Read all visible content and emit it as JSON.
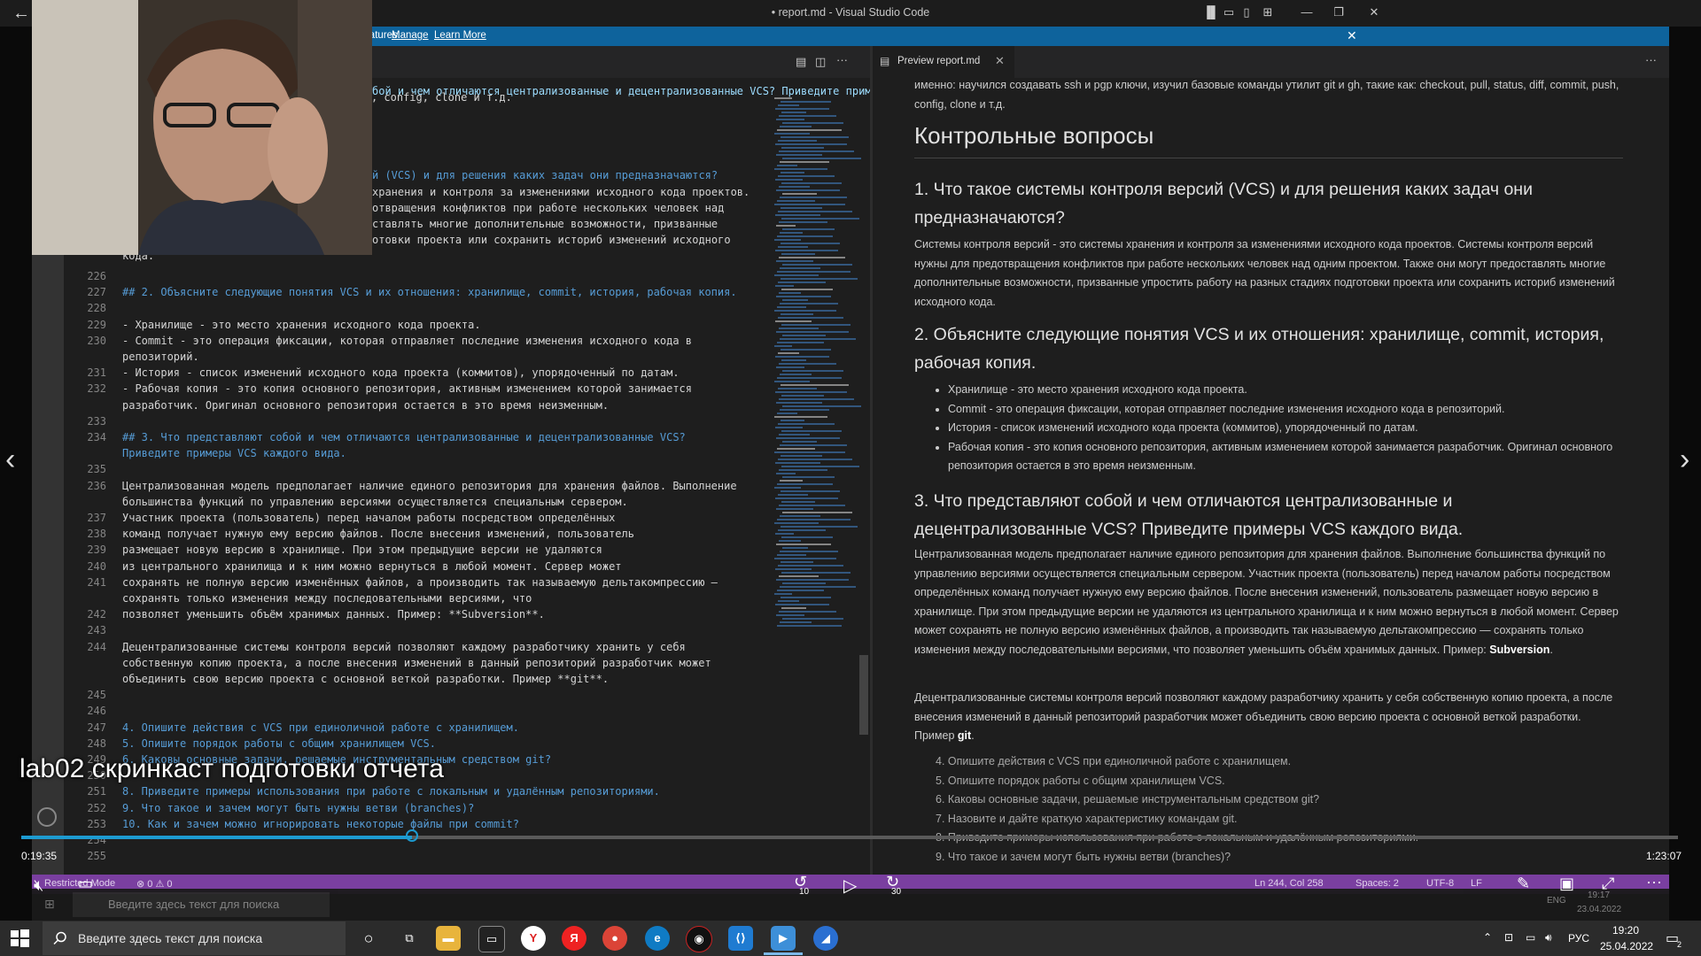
{
  "window": {
    "title": "• report.md - Visual Studio Code"
  },
  "infobar": {
    "message": "to enable all features.",
    "manage": "Manage",
    "learn_more": "Learn More"
  },
  "editor": {
    "line_top": "[], diff, commit, push, config, clone и т.д.",
    "question1_tail": "й (VCS) и для решения каких задач они предназначаются?",
    "q1_body": [
      "хранения и контроля за изменениями исходного кода проектов.",
      "отвращения конфликтов при работе нескольких человек над",
      "ставлять многие дополнительные возможности, призванные",
      "отовки проекта или сохранить историб изменений исходного"
    ],
    "q1_last": "кода.",
    "top_partial": "бой и чем отличаются централизованные и децентрализованные VCS? Приведите примеры V...",
    "lines": [
      {
        "n": "226",
        "t": "",
        "cls": ""
      },
      {
        "n": "227",
        "t": "## 2. Объясните следующие понятия VCS и их отношения: хранилище, commit, история, рабочая копия.",
        "cls": "h"
      },
      {
        "n": "228",
        "t": "",
        "cls": ""
      },
      {
        "n": "229",
        "t": "- Хранилище - это место хранения исходного кода проекта.",
        "cls": ""
      },
      {
        "n": "230",
        "t": "- Commit - это операция фиксации, которая отправляет последние изменения исходного кода в",
        "cls": ""
      },
      {
        "n": "",
        "t": "репозиторий.",
        "cls": ""
      },
      {
        "n": "231",
        "t": "- История - список изменений исходного кода проекта (коммитов), упорядоченный по датам.",
        "cls": ""
      },
      {
        "n": "232",
        "t": "- Рабочая копия - это копия основного репозитория, активным изменением которой занимается",
        "cls": ""
      },
      {
        "n": "",
        "t": "разработчик. Оригинал основного репозитория остается в это время неизменным.",
        "cls": ""
      },
      {
        "n": "233",
        "t": "",
        "cls": ""
      },
      {
        "n": "234",
        "t": "## 3. Что представляют собой и чем отличаются централизованные и децентрализованные VCS?",
        "cls": "h"
      },
      {
        "n": "",
        "t": "Приведите примеры VCS каждого вида.",
        "cls": "h"
      },
      {
        "n": "235",
        "t": "",
        "cls": ""
      },
      {
        "n": "236",
        "t": "Централизованная модель предполагает наличие единого репозитория для хранения файлов. Выполнение",
        "cls": ""
      },
      {
        "n": "",
        "t": "большинства функций по управлению версиями осуществляется специальным сервером.",
        "cls": ""
      },
      {
        "n": "237",
        "t": "Участник проекта (пользователь) перед началом работы посредством определённых",
        "cls": ""
      },
      {
        "n": "238",
        "t": "команд получает нужную ему версию файлов. После внесения изменений, пользователь",
        "cls": ""
      },
      {
        "n": "239",
        "t": "размещает новую версию в хранилище. При этом предыдущие версии не удаляются",
        "cls": ""
      },
      {
        "n": "240",
        "t": "из центрального хранилища и к ним можно вернуться в любой момент. Сервер может",
        "cls": ""
      },
      {
        "n": "241",
        "t": "сохранять не полную версию изменённых файлов, а производить так называемую дельтакомпрессию —",
        "cls": ""
      },
      {
        "n": "",
        "t": "сохранять только изменения между последовательными версиями, что",
        "cls": ""
      },
      {
        "n": "242",
        "t": "позволяет уменьшить объём хранимых данных. Пример: **Subversion**.",
        "cls": ""
      },
      {
        "n": "243",
        "t": "",
        "cls": ""
      },
      {
        "n": "244",
        "t": "Децентрализованные системы контроля версий позволяют каждому разработчику хранить у себя",
        "cls": ""
      },
      {
        "n": "",
        "t": "собственную копию проекта, а после внесения изменений в данный репозиторий разработчик может",
        "cls": ""
      },
      {
        "n": "",
        "t": "объединить свою версию проекта с основной веткой разработки. Пример **git**.",
        "cls": ""
      },
      {
        "n": "245",
        "t": "",
        "cls": ""
      },
      {
        "n": "246",
        "t": "",
        "cls": ""
      },
      {
        "n": "247",
        "t": "4. Опишите действия с VCS при единоличной работе с хранилищем.",
        "cls": "list"
      },
      {
        "n": "248",
        "t": "5. Опишите порядок работы с общим хранилищем VCS.",
        "cls": "list"
      },
      {
        "n": "249",
        "t": "6. Каковы основные задачи, решаемые инструментальным средством git?",
        "cls": "list"
      },
      {
        "n": "250",
        "t": "",
        "cls": ""
      },
      {
        "n": "251",
        "t": "8. Приведите примеры использования при работе с локальным и удалённым репозиториями.",
        "cls": "list"
      },
      {
        "n": "252",
        "t": "9. Что такое и зачем могут быть нужны ветви (branches)?",
        "cls": "list"
      },
      {
        "n": "253",
        "t": "10. Как и зачем можно игнорировать некоторые файлы при commit?",
        "cls": "list"
      },
      {
        "n": "254",
        "t": "",
        "cls": ""
      },
      {
        "n": "255",
        "t": "",
        "cls": ""
      }
    ]
  },
  "preview": {
    "tab_label": "Preview report.md",
    "intro": "именно: научился создавать ssh и pgp ключи, изучил базовые команды утилит git и gh, такие как: checkout, pull, status, diff, commit, push, config, clone и т.д.",
    "h1": "Контрольные вопросы",
    "q1_title": "1. Что такое системы контроля версий (VCS) и для решения каких задач они предназначаются?",
    "q1_text": "Системы контроля версий - это системы хранения и контроля за изменениями исходного кода проектов. Системы контроля версий нужны для предотвращения конфликтов при работе нескольких человек над одним проектом. Также они могут предоставлять многие дополнительные возможности, призванные упростить работу на разных стадиях подготовки проекта или сохранить историб изменений исходного кода.",
    "q2_title": "2. Объясните следующие понятия VCS и их отношения: хранилище, commit, история, рабочая копия.",
    "q2_items": [
      "Хранилище - это место хранения исходного кода проекта.",
      "Commit - это операция фиксации, которая отправляет последние изменения исходного кода в репозиторий.",
      "История - список изменений исходного кода проекта (коммитов), упорядоченный по датам.",
      "Рабочая копия - это копия основного репозитория, активным изменением которой занимается разработчик. Оригинал основного репозитория остается в это время неизменным."
    ],
    "q3_title": "3. Что представляют собой и чем отличаются централизованные и децентрализованные VCS? Приведите примеры VCS каждого вида.",
    "q3_text": "Централизованная модель предполагает наличие единого репозитория для хранения файлов. Выполнение большинства функций по управлению версиями осуществляется специальным сервером. Участник проекта (пользователь) перед началом работы посредством определённых команд получает нужную ему версию файлов. После внесения изменений, пользователь размещает новую версию в хранилище. При этом предыдущие версии не удаляются из центрального хранилища и к ним можно вернуться в любой момент. Сервер может сохранять не полную версию изменённых файлов, а производить так называемую дельтакомпрессию — сохранять только изменения между последовательными версиями, что позволяет уменьшить объём хранимых данных. Пример:",
    "q3_bold": "Subversion",
    "q3_text2": "Децентрализованные системы контроля версий позволяют каждому разработчику хранить у себя собственную копию проекта, а после внесения изменений в данный репозиторий разработчик может объединить свою версию проекта с основной веткой разработки. Пример",
    "q3_bold2": "git",
    "list": [
      "4. Опишите действия с VCS при единоличной работе с хранилищем.",
      "5. Опишите порядок работы с общим хранилищем VCS.",
      "6. Каковы основные задачи, решаемые инструментальным средством git?",
      "7. Назовите и дайте краткую характеристику командам git.",
      "8. Приведите примеры использования при работе с локальным и удалённым репозиториями.",
      "9. Что такое и зачем могут быть нужны ветви (branches)?"
    ]
  },
  "video": {
    "caption": "lab02 скринкаст подготовки отчета",
    "elapsed": "0:19:35",
    "duration": "1:23:07",
    "progress": 0.2357,
    "skip_back": "10",
    "skip_forward": "30"
  },
  "statusbar": {
    "mode": "Restricted Mode",
    "problems": "⊗ 0 ⚠ 0",
    "position": "Ln 244, Col 258",
    "spaces": "Spaces: 2",
    "encoding": "UTF-8",
    "eol": "LF"
  },
  "inner_taskbar": {
    "search_placeholder": "Введите здесь текст для поиска",
    "time": "19:17",
    "date": "23.04.2022",
    "lang": "ENG"
  },
  "taskbar": {
    "search_placeholder": "Введите здесь текст для поиска",
    "lang": "РУС",
    "time": "19:20",
    "date": "25.04.2022",
    "notification_count": "2"
  }
}
